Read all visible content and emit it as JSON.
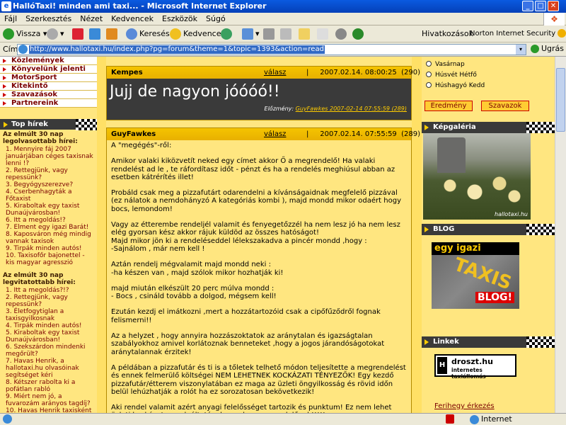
{
  "window": {
    "title": "HallóTaxi! minden ami taxi... - Microsoft Internet Explorer"
  },
  "menu": [
    "Fájl",
    "Szerkesztés",
    "Nézet",
    "Kedvencek",
    "Eszközök",
    "Súgó"
  ],
  "toolbar": {
    "back": "Vissza",
    "search": "Keresés",
    "favorites": "Kedvencek",
    "links": "Hivatkozások",
    "norton": "Norton Internet Security"
  },
  "address": {
    "label": "Cím",
    "url": "http://www.hallotaxi.hu/index.php?pg=forum&theme=1&topic=1393&action=read",
    "go": "Ugrás"
  },
  "status": {
    "zone": "Internet"
  },
  "left": {
    "nav": [
      "Közlemények",
      "Könyvelünk jelenti",
      "MotorSport",
      "Kitekintő",
      "Szavazások",
      "Partnereink"
    ],
    "top_title": "Top hírek",
    "read_title": "Az elmúlt 30 nap legolvasottabb hírei:",
    "read": [
      "1. Mennyire fáj 2007 januárjában céges taxisnak lenni !?",
      "2. Rettegjünk, vagy repessünk?",
      "3. Begyógyszerezve?",
      "4. Cserbenhagyták a Főtaxist",
      "5. Kiraboltak egy taxist Dunaújvárosban!",
      "6. Itt a megoldás!?",
      "7. Elment egy igazi Barát!",
      "8. Kaposváron még mindig vannak taxisok",
      "9. Tirpák minden autós!",
      "10. Taxisofőr bajonettel - kis magyar agresszió"
    ],
    "comment_title": "Az elmúlt 30 nap legvitatottabb hírei:",
    "comment": [
      "1. Itt a megoldás?!?",
      "2. Rettegjünk, vagy repessünk?",
      "3. Életfogytiglan a taxisgyilkosnak",
      "4. Tirpák minden autós!",
      "5. Kiraboltak egy taxist Dunaújvárosban!",
      "6. Szekszárdon mindenki megőrült?",
      "7. Havas Henrik, a hallotaxi.hu olvasóinak segítséget kéri",
      "8. Kétszer rabolta ki a pofátlan rabló",
      "9. Miért nem jó, a fuvarozám arányos tagdíj?",
      "10. Havas Henrik taxisként"
    ]
  },
  "posts": [
    {
      "author": "Kempes",
      "reply": "válasz",
      "date": "2007.02.14. 08:00:25",
      "num": "(290)",
      "big": "Jujj de nagyon jóóóó!!",
      "prev_label": "Előzmény:",
      "prev": "GuyFawkes 2007-02-14 07:55:59 (289)"
    },
    {
      "author": "GuyFawkes",
      "reply": "válasz",
      "date": "2007.02.14. 07:55:59",
      "num": "(289)",
      "lines": [
        "A \"megégés\"-ről:",
        "",
        "Amikor valaki kiközvetít neked egy címet akkor Ő a megrendelő! Ha valaki rendelést ad le , te ráfordítasz időt - pénzt és ha a rendelés meghiúsul abban az esetben kátrérítés illet!",
        "",
        "Probáld csak meg a pizzafutárt odarendelni a kívánságaidnak megfelelő pizzával (ez nálatok a nemdohányzó A kategóriás kombi ), majd mondd mikor odaért hogy bocs, lemondom!",
        "",
        "Vagy az étterembe rendeljél valamit és fenyegetőzzél ha nem lesz jó ha nem lesz elég gyorsan kész akkor rájuk küldöd az összes hatóságot!",
        "Majd mikor jön ki a rendeléseddel lélekszakadva a pincér mondd ,hogy :",
        "-Sajnálom , már nem kell !",
        "",
        "Aztán rendelj mégvalamit majd mondd neki :",
        "-ha készen van , majd szólok mikor hozhatják ki!",
        "",
        "majd miután elkészült 20 perc múlva mondd :",
        "- Bocs , csináld tovább a dolgod, mégsem kell!",
        "",
        "Ezután kezdj el imátkozni ,mert a hozzátartozóid csak a cipőfűződről fognak felismerni!!",
        "",
        "Az a helyzet , hogy annyira hozzászoktatok az aránytalan és igazságtalan szabályokhoz amivel korlátoznak benneteket ,hogy a jogos járandóságotokat aránytalannak érzitek!",
        "",
        "A példában a pizzafutár és ti is a tőletek telhető módon teljesítette a megrendelést és ennek felmerülő költségei NEM LEHETNEK KOCKÁZATI TÉNYEZŐK! Egy kezdő pizzafutár/étterem viszonylatában ez maga az üzleti öngyilkosság és rövid időn belül lehúzhatják a rolót ha ez sorozatosan bekövetkezik!",
        "",
        "Aki rendel valamit azért anyagi felelősséget tartozik és punktum! Ez nem lehet üzleti kockázat a szolgáltatónak , csak a megrendelőnek!!!!!"
      ]
    }
  ],
  "right": {
    "poll_options": [
      "Vasárnap",
      "Húsvét Hétfő",
      "Húshagyó Kedd"
    ],
    "poll_result": "Eredmény",
    "poll_vote": "Szavazok",
    "gallery_title": "Képgaléria",
    "gallery_caption": "hallotaxi.hu",
    "blog_title": "BLOG",
    "blog_text1": "egy igazi",
    "blog_text2": "TAXIS",
    "blog_text3": "BLOG!",
    "links_title": "Linkek",
    "droszt_line1": "droszt.hu",
    "droszt_line2": "internetes taxiállomás",
    "ferihegy": "Ferihegy érkezés"
  }
}
